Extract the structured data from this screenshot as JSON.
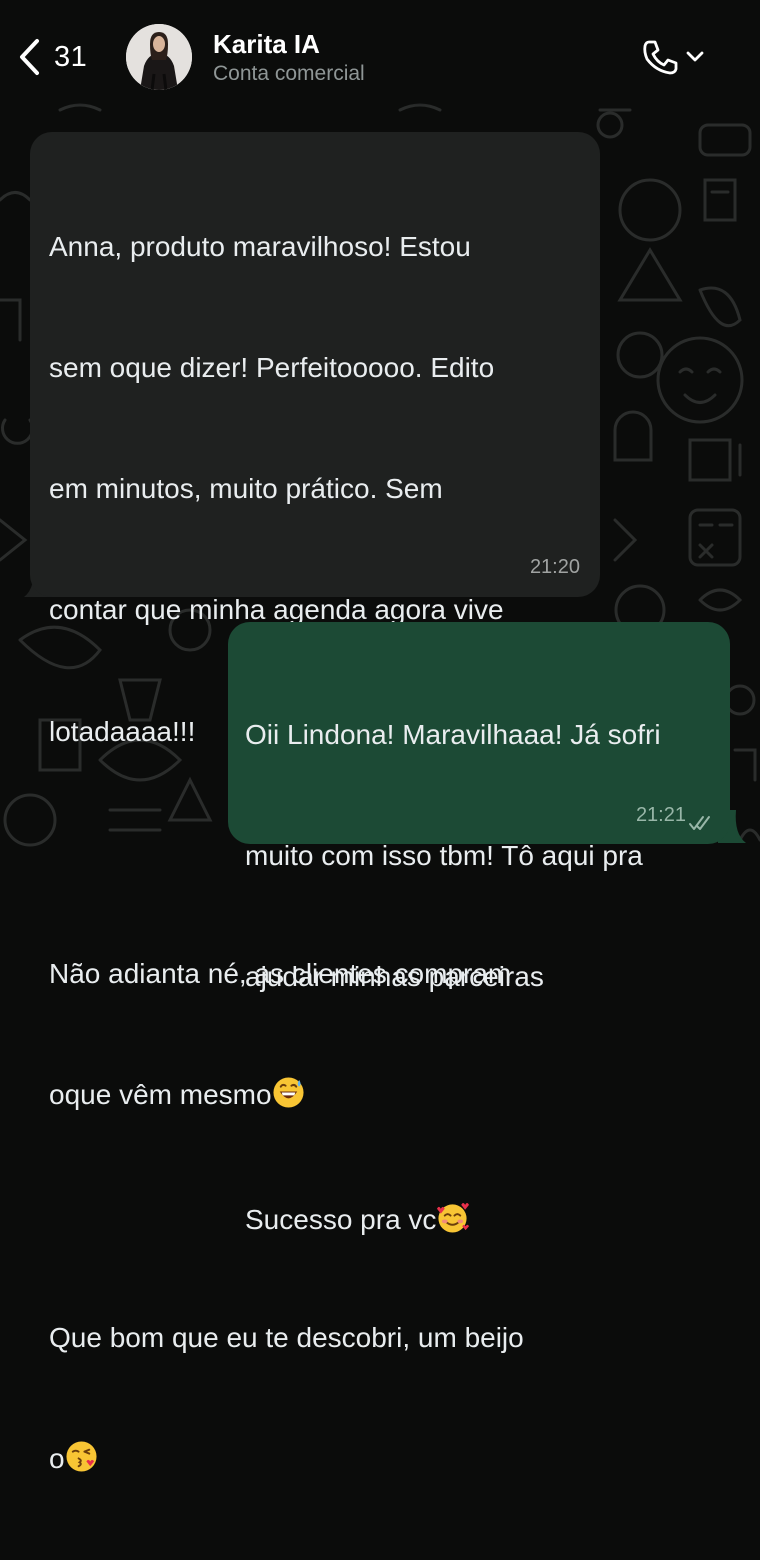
{
  "header": {
    "back_count": "31",
    "contact_name": "Karita IA",
    "contact_subtitle": "Conta comercial"
  },
  "messages": {
    "incoming": {
      "lines": [
        "Anna, produto maravilhoso! Estou",
        "sem oque dizer! Perfeitooooo. Edito",
        "em minutos, muito prático. Sem",
        "contar que minha agenda agora vive",
        "lotadaaaa!!!",
        "Não adianta né, as clientes compram",
        "oque vêm mesmo",
        "Que bom que eu te descobri, um beijo",
        "o"
      ],
      "emojis": [
        "grinning-sweat-emoji",
        "kiss-emoji"
      ],
      "time": "21:20"
    },
    "outgoing": {
      "lines": [
        "Oii Lindona! Maravilhaaa! Já sofri",
        "muito com isso tbm! Tô aqui pra",
        "ajudar minhas parceiras",
        "Sucesso pra vc"
      ],
      "emojis": [
        "smiling-hearts-emoji"
      ],
      "time": "21:21",
      "status": "read-double-check-icon"
    }
  },
  "colors": {
    "background": "#0b0c0b",
    "incoming_bubble": "#1f2120",
    "outgoing_bubble": "#1c4a35",
    "text": "#e9edef"
  }
}
